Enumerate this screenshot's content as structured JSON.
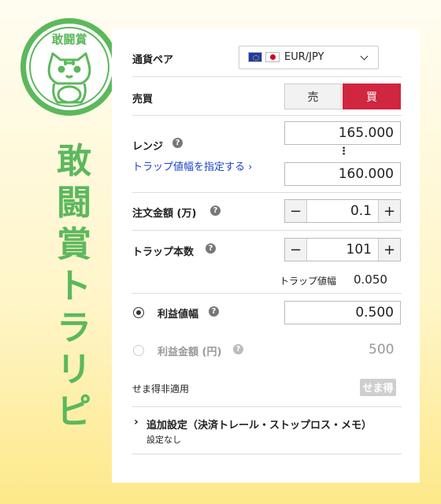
{
  "branding": {
    "stamp_text": "敢闘賞",
    "side_title": [
      "敢",
      "闘",
      "賞",
      "ト",
      "ラ",
      "リ",
      "ピ"
    ],
    "accent_color": "#5cb85c"
  },
  "form": {
    "currency": {
      "label": "通貨ペア",
      "value": "EUR/JPY",
      "icons": [
        "eu-flag-icon",
        "jp-flag-icon",
        "chevron-down-icon"
      ]
    },
    "side": {
      "label": "売買",
      "sell": "売",
      "buy": "買",
      "selected": "買",
      "buy_color": "#d0263f"
    },
    "range": {
      "label": "レンジ",
      "link": "トラップ値幅を指定する ›",
      "upper": "165.000",
      "dots": "⋮",
      "lower": "160.000"
    },
    "order_amount": {
      "label": "注文金額 (万)",
      "value": "0.1",
      "minus": "−",
      "plus": "+"
    },
    "trap_count": {
      "label": "トラップ本数",
      "value": "101",
      "minus": "−",
      "plus": "+"
    },
    "trap_width": {
      "label": "トラップ値幅",
      "value": "0.050"
    },
    "profit_width": {
      "label": "利益値幅",
      "value": "0.500",
      "selected": true
    },
    "profit_amount": {
      "label": "利益金額 (円)",
      "value": "500",
      "selected": false
    },
    "sema": {
      "label": "せま得非適用",
      "badge": "せま得"
    },
    "advanced": {
      "title": "追加設定（決済トレール・ストップロス・メモ）",
      "sub": "設定なし",
      "arrow": "›"
    },
    "help_symbol": "?"
  }
}
